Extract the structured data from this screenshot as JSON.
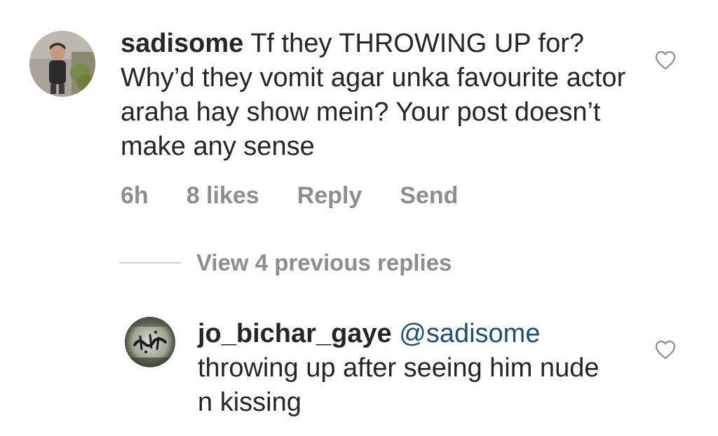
{
  "comment": {
    "avatar_icon": "child-photo-avatar",
    "username": "sadisome",
    "text": "Tf they THROWING UP for? Why’d they vomit agar unka favourite actor araha hay show mein? Your post doesn’t make any sense",
    "time": "6h",
    "likes": "8 likes",
    "reply_label": "Reply",
    "send_label": "Send",
    "like_icon": "heart-outline-icon"
  },
  "view_replies": {
    "label": "View 4 previous replies"
  },
  "reply": {
    "avatar_icon": "calligraphy-logo-avatar",
    "username": "jo_bichar_gaye",
    "mention": "@sadisome",
    "text": "throwing up after seeing him nude n kissing",
    "like_icon": "heart-outline-icon"
  },
  "colors": {
    "text": "#262626",
    "meta": "#8e8e8e",
    "mention": "#1f4e79",
    "divider": "#cfcfcf"
  }
}
